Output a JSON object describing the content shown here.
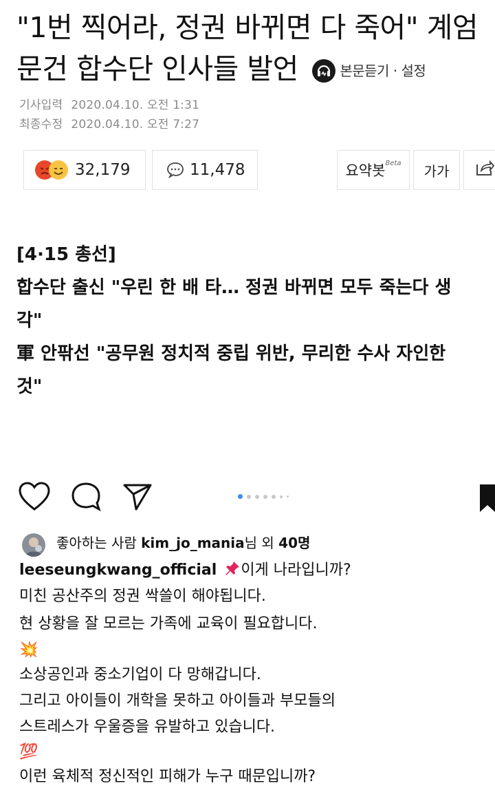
{
  "article": {
    "headline_line1": "\"1번 찍어라, 정권 바뀌면 다 죽어\" 계엄",
    "headline_line2": "문건 합수단 인사들 발언",
    "listen_label": "본문듣기 · 설정",
    "published_label": "기사입력",
    "published_value": "2020.04.10. 오전 1:31",
    "updated_label": "최종수정",
    "updated_value": "2020.04.10. 오전 7:27"
  },
  "toolbar": {
    "reaction_count": "32,179",
    "comment_count": "11,478",
    "summary_label": "요약봇",
    "summary_badge": "Beta",
    "font_label": "가가"
  },
  "lead": {
    "tag": "[4·15 총선]",
    "line1": "합수단 출신 \"우린 한 배 타… 정권 바뀌면 모두 죽는다 생",
    "line2": "각\"",
    "line3": "軍 안팎선 \"공무원 정치적 중립 위반, 무리한 수사 자인한",
    "line4": "것\""
  },
  "instagram": {
    "likes_prefix": "좋아하는 사람 ",
    "likes_user": "kim_jo_mania",
    "likes_mid": "님 외 ",
    "likes_count": "40명",
    "author": "leeseungkwang_official",
    "caption_line1": "이게 나라입니까?",
    "lines": [
      "미친 공산주의 정권 싹쓸이 해야됩니다.",
      "현 상황을 잘 모르는 가족에 교육이 필요합니다.",
      "💥",
      "소상공인과 중소기업이 다 망해갑니다.",
      "그리고 아이들이 개학을 못하고 아이들과 부모들의",
      "스트레스가 우울증을 유발하고 있습니다.",
      "💯",
      "이런 육체적 정신적인 피해가 누구 때문입니까?"
    ]
  },
  "colors": {
    "accent": "#3a8ef0",
    "meta": "#8a8a8a",
    "angry": "#e8472c",
    "smile": "#f6c343"
  }
}
